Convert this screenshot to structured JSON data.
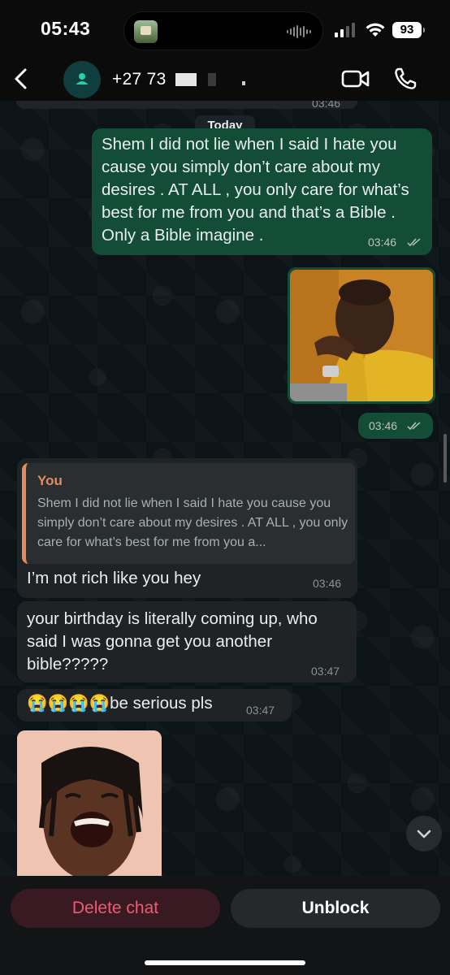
{
  "status_bar": {
    "time": "05:43",
    "battery": "93"
  },
  "header": {
    "contact_name": "+27 73",
    "icons": {
      "back": "chevron-left-icon",
      "avatar": "person-icon",
      "video": "video-camera-icon",
      "call": "phone-icon"
    }
  },
  "chat": {
    "previous_time": "03:46",
    "date_divider": "Today",
    "messages": [
      {
        "direction": "outgoing",
        "text": "Shem I did not lie when I said I hate you cause you simply don’t care about my desires . AT ALL , you only care for what’s best for me from you and that’s a Bible . Only a Bible imagine .",
        "time": "03:46",
        "status": "read"
      },
      {
        "direction": "outgoing",
        "type": "image",
        "time": "03:46",
        "status": "read"
      },
      {
        "direction": "incoming",
        "reply_to": {
          "author": "You",
          "text": "Shem I did not lie when I said I hate you cause you simply don’t care about my desires . AT ALL , you only care for what’s best for me from you a..."
        },
        "text": "I’m not rich like you hey",
        "time": "03:46"
      },
      {
        "direction": "incoming",
        "text": "your birthday is literally coming up, who said I was gonna get you another bible?????",
        "time": "03:47"
      },
      {
        "direction": "incoming",
        "text": "😭😭😭😭be serious pls",
        "time": "03:47"
      },
      {
        "direction": "incoming",
        "type": "image"
      }
    ]
  },
  "actions": {
    "delete_label": "Delete chat",
    "unblock_label": "Unblock"
  },
  "colors": {
    "outgoing_bubble": "#144d37",
    "incoming_bubble": "#1f2326",
    "delete_text": "#f05a6e",
    "quote_accent": "#e48a5e"
  }
}
